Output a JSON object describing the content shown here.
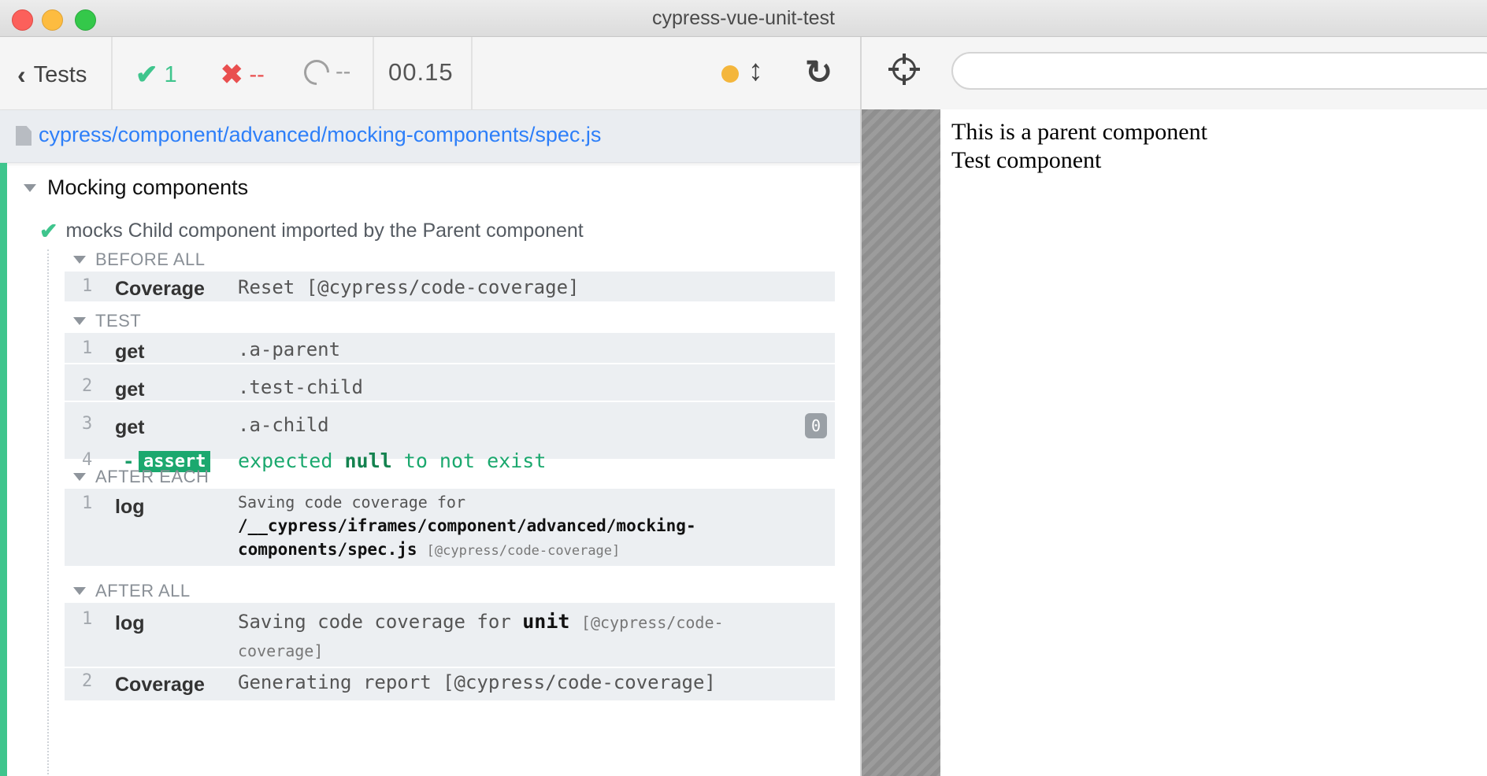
{
  "window": {
    "title": "cypress-vue-unit-test"
  },
  "header": {
    "back_label": "Tests",
    "passed": "1",
    "failed": "--",
    "pending": "--",
    "duration": "00.15",
    "running_indicator_color": "#f4b63c",
    "icons": [
      "chevron-left-icon",
      "check-icon",
      "x-icon",
      "spinner-icon",
      "resize-icon",
      "reload-icon"
    ]
  },
  "spec": {
    "path": "cypress/component/advanced/mocking-components/spec.js"
  },
  "suite": {
    "title": "Mocking components",
    "test": {
      "title": "mocks Child component imported by the Parent component",
      "before_all": {
        "label": "BEFORE ALL",
        "commands": [
          {
            "num": "1",
            "name": "Coverage",
            "message": "Reset [@cypress/code-coverage]"
          }
        ]
      },
      "test_body": {
        "label": "TEST",
        "commands": [
          {
            "num": "1",
            "name": "get",
            "message": ".a-parent"
          },
          {
            "num": "2",
            "name": "get",
            "message": ".test-child"
          },
          {
            "num": "3",
            "name": "get",
            "message": ".a-child",
            "badge": "0"
          }
        ],
        "assert": {
          "num": "4",
          "dash": "-",
          "name": "assert",
          "msg_pre": "expected",
          "msg_value": "null",
          "msg_post": "to not exist"
        }
      },
      "after_each": {
        "label": "AFTER EACH",
        "commands": [
          {
            "num": "1",
            "name": "log",
            "line1": "Saving code coverage for",
            "line2": "/__cypress/iframes/component/advanced/mocking-",
            "line3": "components/spec.js",
            "suffix": "[@cypress/code-coverage]"
          }
        ]
      },
      "after_all": {
        "label": "AFTER ALL",
        "commands": [
          {
            "num": "1",
            "name": "log",
            "pre": "Saving code coverage for",
            "bold": "unit",
            "suffix1": "[@cypress/code-",
            "suffix2": "coverage]"
          },
          {
            "num": "2",
            "name": "Coverage",
            "message": "Generating report [@cypress/code-coverage]"
          }
        ]
      }
    }
  },
  "aut": {
    "url_value": "",
    "lines": [
      "This is a parent component",
      "Test component"
    ]
  }
}
